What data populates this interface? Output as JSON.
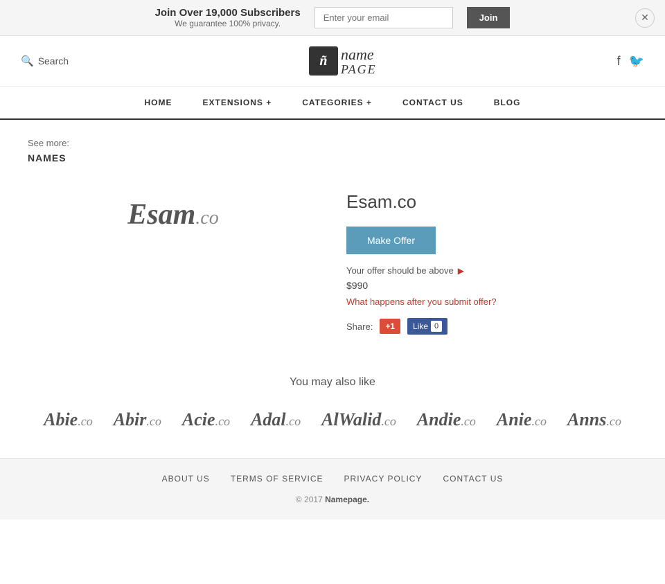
{
  "banner": {
    "title": "Join Over 19,000 Subscribers",
    "subtitle": "We guarantee 100% privacy.",
    "email_placeholder": "Enter your email",
    "join_label": "Join"
  },
  "header": {
    "search_label": "Search",
    "logo_icon": "ñ",
    "logo_name": "name",
    "logo_page": "PAGE"
  },
  "nav": {
    "items": [
      {
        "label": "HOME",
        "id": "home"
      },
      {
        "label": "EXTENSIONS +",
        "id": "extensions"
      },
      {
        "label": "CATEGORIES +",
        "id": "categories"
      },
      {
        "label": "CONTACT US",
        "id": "contact"
      },
      {
        "label": "BLOG",
        "id": "blog"
      }
    ]
  },
  "breadcrumb": {
    "see_more": "See more:",
    "link_label": "NAMES"
  },
  "domain": {
    "name": "Esam",
    "tld": ".co",
    "full": "Esam.co",
    "make_offer_label": "Make Offer",
    "offer_hint": "Your offer should be above",
    "offer_price": "$990",
    "offer_link_label": "What happens after you submit offer?",
    "share_label": "Share:",
    "gplus_label": "+1",
    "fb_label": "Like",
    "fb_count": "0"
  },
  "similar": {
    "title": "You may also like",
    "items": [
      {
        "name": "Abie",
        "tld": ".co"
      },
      {
        "name": "Abir",
        "tld": ".co"
      },
      {
        "name": "Acie",
        "tld": ".co"
      },
      {
        "name": "Adal",
        "tld": ".co"
      },
      {
        "name": "AlWalid",
        "tld": ".co"
      },
      {
        "name": "Andie",
        "tld": ".co"
      },
      {
        "name": "Anie",
        "tld": ".co"
      },
      {
        "name": "Anns",
        "tld": ".co"
      }
    ]
  },
  "footer": {
    "links": [
      {
        "label": "ABOUT US",
        "id": "about"
      },
      {
        "label": "TERMS OF SERVICE",
        "id": "terms"
      },
      {
        "label": "PRIVACY POLICY",
        "id": "privacy"
      },
      {
        "label": "CONTACT US",
        "id": "contact"
      }
    ],
    "copy": "© 2017",
    "brand": "Namepage."
  }
}
